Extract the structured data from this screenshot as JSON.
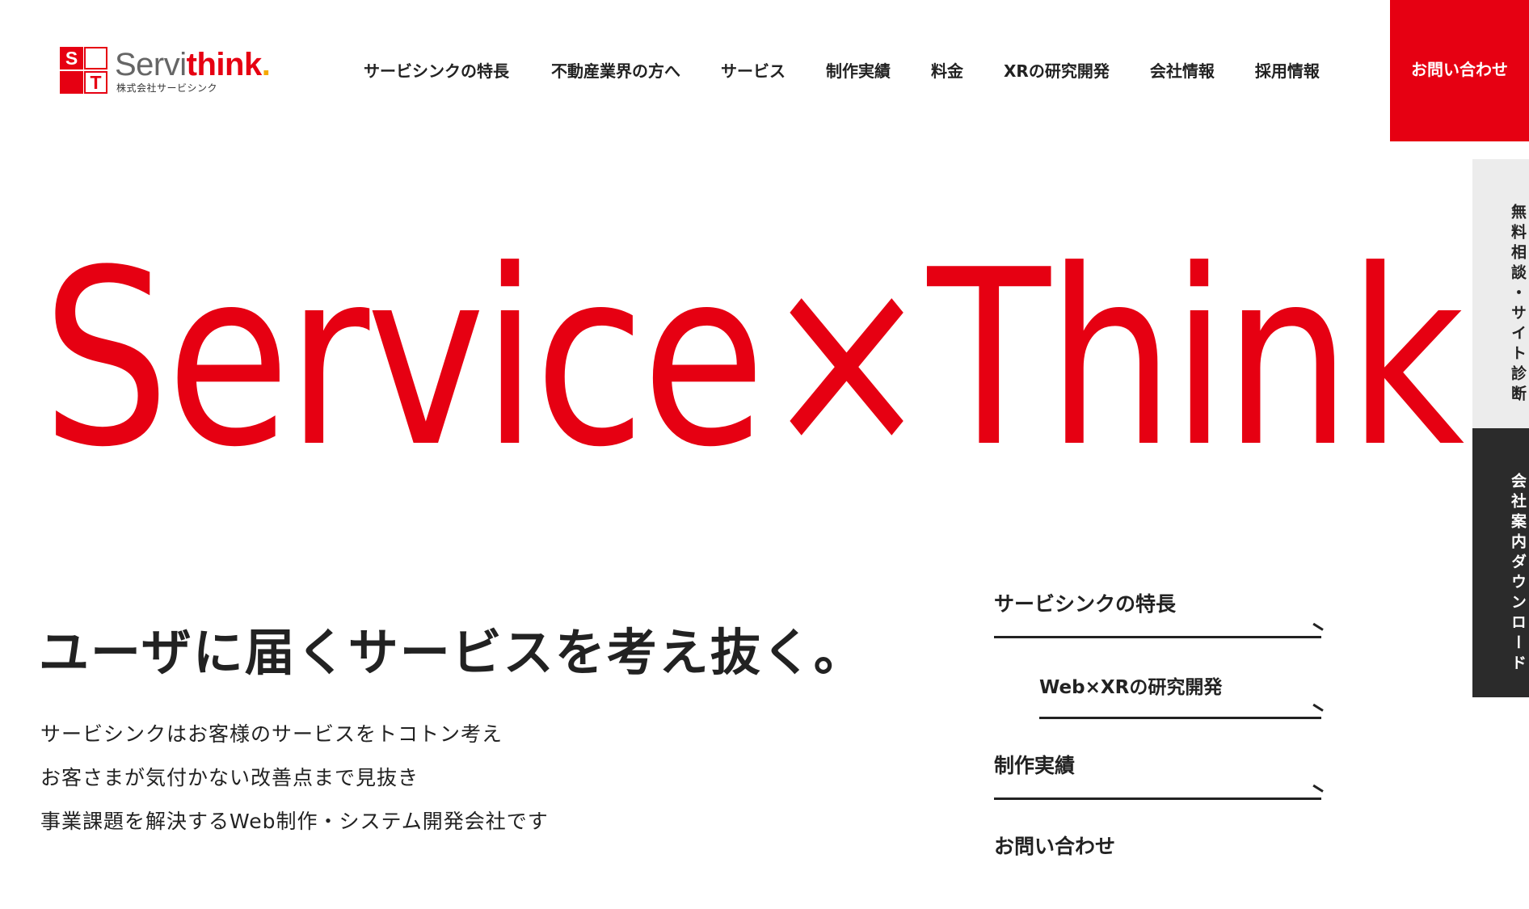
{
  "header": {
    "logo": {
      "mark_letters": [
        "S",
        "T"
      ],
      "name_gray": "Servi",
      "name_red": "think",
      "name_dot": ".",
      "company": "株式会社サービシンク"
    },
    "nav": [
      "サービシンクの特長",
      "不動産業界の方へ",
      "サービス",
      "制作実績",
      "料金",
      "XRの研究開発",
      "会社情報",
      "採用情報"
    ],
    "contact_label": "お問い合わせ"
  },
  "side_tabs": {
    "consult": "無料相談・サイト診断",
    "download": "会社案内ダウンロード"
  },
  "hero": {
    "title": "Service×Think",
    "tagline": "ユーザに届くサービスを考え抜く。",
    "description": [
      "サービシンクはお客様のサービスをトコトン考え",
      "お客さまが気付かない改善点まで見抜き",
      "事業課題を解決するWeb制作・システム開発会社です"
    ]
  },
  "right_menu": [
    "サービシンクの特長",
    "Web×XRの研究開発",
    "制作実績",
    "お問い合わせ"
  ],
  "colors": {
    "brand_red": "#e60012",
    "logo_dot": "#f5a800",
    "dark_tab": "#2b2b2b",
    "light_tab": "#ececec"
  }
}
